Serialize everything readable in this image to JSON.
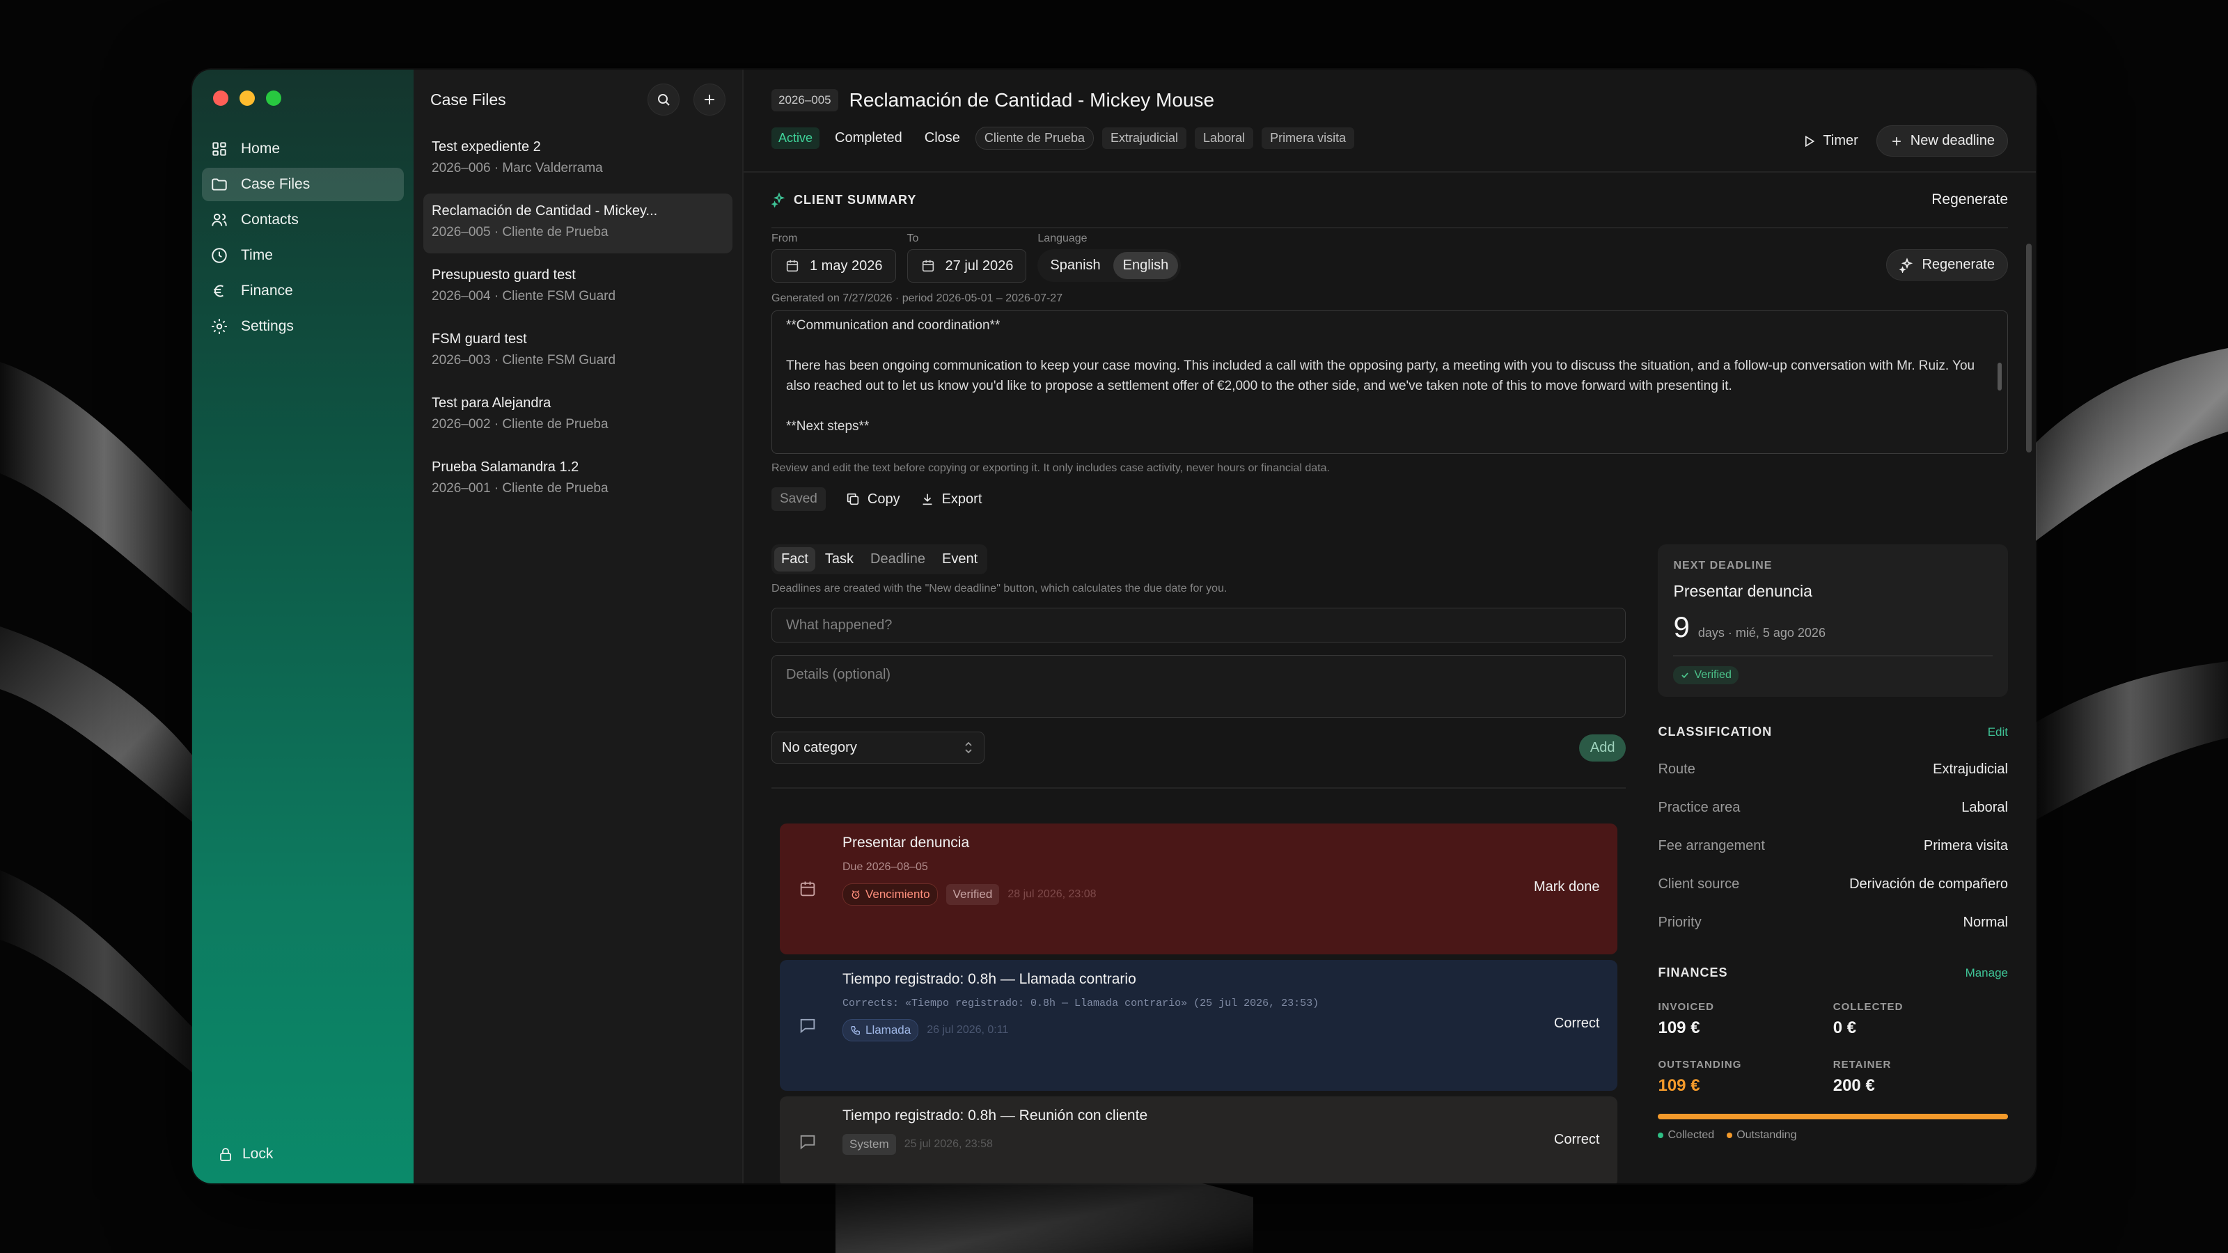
{
  "sidebar": {
    "items": [
      {
        "label": "Home",
        "icon": "grid-icon"
      },
      {
        "label": "Case Files",
        "icon": "folder-icon",
        "active": true
      },
      {
        "label": "Contacts",
        "icon": "users-icon"
      },
      {
        "label": "Time",
        "icon": "clock-icon"
      },
      {
        "label": "Finance",
        "icon": "euro-icon"
      },
      {
        "label": "Settings",
        "icon": "gear-icon"
      }
    ],
    "lock_label": "Lock"
  },
  "caselist": {
    "title": "Case Files",
    "cases": [
      {
        "title": "Test expediente 2",
        "sub": "2026–006 · Marc Valderrama"
      },
      {
        "title": "Reclamación de Cantidad - Mickey...",
        "sub": "2026–005 · Cliente de Prueba",
        "active": true
      },
      {
        "title": "Presupuesto guard test",
        "sub": "2026–004 · Cliente FSM Guard"
      },
      {
        "title": "FSM guard test",
        "sub": "2026–003 · Cliente FSM Guard"
      },
      {
        "title": "Test para Alejandra",
        "sub": "2026–002 · Cliente de Prueba"
      },
      {
        "title": "Prueba Salamandra 1.2",
        "sub": "2026–001 · Cliente de Prueba"
      }
    ]
  },
  "header": {
    "code": "2026–005",
    "title": "Reclamación de Cantidad - Mickey Mouse",
    "status_active": "Active",
    "status_completed": "Completed",
    "status_close": "Close",
    "tags": [
      "Cliente de Prueba",
      "Extrajudicial",
      "Laboral",
      "Primera visita"
    ],
    "timer_label": "Timer",
    "new_deadline_label": "New deadline"
  },
  "summary": {
    "title": "CLIENT SUMMARY",
    "regenerate_link": "Regenerate",
    "from_label": "From",
    "from_value": "1 may 2026",
    "to_label": "To",
    "to_value": "27 jul 2026",
    "language_label": "Language",
    "lang_spanish": "Spanish",
    "lang_english": "English",
    "regenerate_button": "Regenerate",
    "generated": "Generated on 7/27/2026 · period 2026-05-01 – 2026-07-27",
    "text_line1": "**Communication and coordination**",
    "text_line2": "There has been ongoing communication to keep your case moving. This included a call with the opposing party, a meeting with you to discuss the situation, and a follow-up conversation with Mr. Ruiz. You also reached out to let us know you'd like to propose a settlement offer of €2,000 to the other side, and we've taken note of this to move forward with presenting it.",
    "text_line3": "**Next steps**",
    "hint": "Review and edit the text before copying or exporting it. It only includes case activity, never hours or financial data.",
    "saved": "Saved",
    "copy": "Copy",
    "export": "Export"
  },
  "entry": {
    "tabs": [
      "Fact",
      "Task",
      "Deadline",
      "Event"
    ],
    "hint": "Deadlines are created with the \"New deadline\" button, which calculates the due date for you.",
    "what_placeholder": "What happened?",
    "details_placeholder": "Details (optional)",
    "category": "No category",
    "add": "Add"
  },
  "events": [
    {
      "title": "Presentar denuncia",
      "sub": "Due 2026–08–05",
      "tag1": "Vencimiento",
      "tag2": "Verified",
      "time": "28 jul 2026, 23:08",
      "action": "Mark done"
    },
    {
      "title": "Tiempo registrado: 0.8h — Llamada contrario",
      "sub": "Corrects: «Tiempo registrado: 0.8h — Llamada contrario» (25 jul 2026, 23:53)",
      "tag1": "Llamada",
      "time": "26 jul 2026, 0:11",
      "action": "Correct"
    },
    {
      "title": "Tiempo registrado: 0.8h — Reunión con cliente",
      "tag1": "System",
      "time": "25 jul 2026, 23:58",
      "action": "Correct"
    }
  ],
  "deadline_card": {
    "caption": "NEXT DEADLINE",
    "title": "Presentar denuncia",
    "days": "9",
    "days_text": "days · mié, 5 ago 2026",
    "verified": "Verified"
  },
  "classification": {
    "title": "CLASSIFICATION",
    "edit": "Edit",
    "rows": [
      {
        "k": "Route",
        "v": "Extrajudicial"
      },
      {
        "k": "Practice area",
        "v": "Laboral"
      },
      {
        "k": "Fee arrangement",
        "v": "Primera visita"
      },
      {
        "k": "Client source",
        "v": "Derivación de compañero"
      },
      {
        "k": "Priority",
        "v": "Normal"
      }
    ]
  },
  "finances": {
    "title": "FINANCES",
    "manage": "Manage",
    "invoiced_label": "INVOICED",
    "invoiced": "109 €",
    "collected_label": "COLLECTED",
    "collected": "0 €",
    "outstanding_label": "OUTSTANDING",
    "outstanding": "109 €",
    "retainer_label": "RETAINER",
    "retainer": "200 €",
    "collected_fraction": 0.0,
    "outstanding_fraction": 1.0,
    "legend_collected": "Collected",
    "legend_outstanding": "Outstanding"
  },
  "colors": {
    "accent": "#2fbf85",
    "orange": "#f39a2b",
    "deadline_bg": "#4a1717",
    "event_blue_bg": "#1b2538",
    "event_gray_bg": "#262524"
  }
}
